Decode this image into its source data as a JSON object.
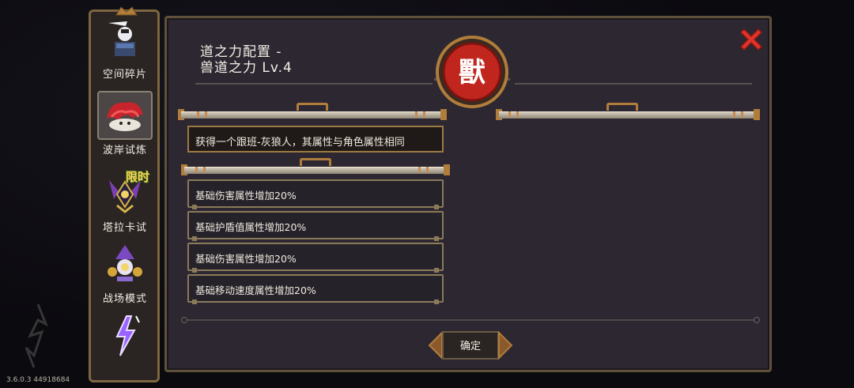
{
  "version": "3.6.0.3 44918684",
  "sidebar": {
    "items": [
      {
        "label": "空间碎片",
        "icon": "space-fragment-icon"
      },
      {
        "label": "波岸试炼",
        "icon": "shore-trial-icon",
        "active": true
      },
      {
        "label": "塔拉卡试",
        "icon": "taraka-trial-icon",
        "badge": "限时"
      },
      {
        "label": "战场模式",
        "icon": "battlefield-mode-icon"
      },
      {
        "label": "",
        "icon": "lightning-mode-icon"
      }
    ]
  },
  "dialog": {
    "title_line1": "道之力配置 -",
    "title_line2": "兽道之力 Lv.4",
    "emblem_char": "獸",
    "effect_text": "获得一个跟班-灰狼人，其属性与角色属性相同",
    "attributes": [
      "基础伤害属性增加20%",
      "基础护盾值属性增加20%",
      "基础伤害属性增加20%",
      "基础移动速度属性增加20%"
    ],
    "confirm_label": "确定"
  },
  "colors": {
    "accent_gold": "#b07d3c",
    "emblem_red": "#c0261e",
    "close_red": "#e0342a",
    "panel_bg": "#2c2730"
  }
}
